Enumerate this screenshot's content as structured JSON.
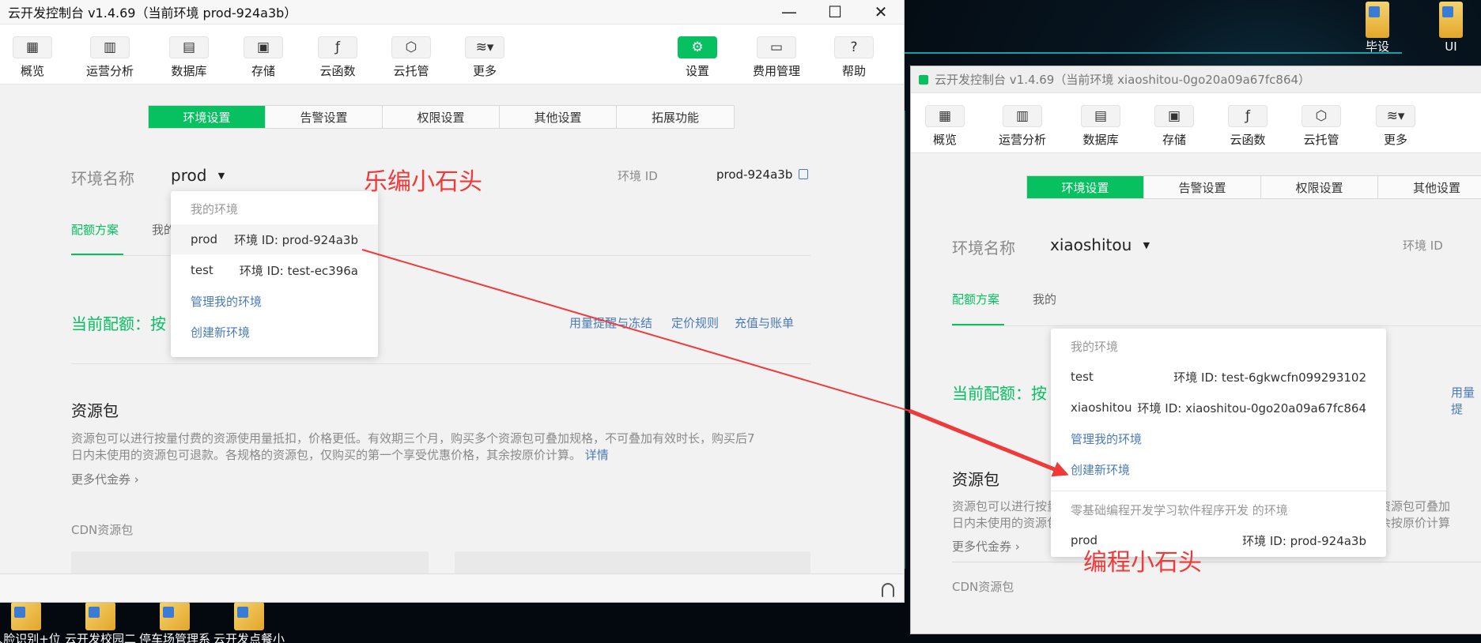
{
  "desktop": {
    "icons_bottom": [
      "人脸识别+位置签到",
      "云开发校园二手交易",
      "停车场管理系统",
      "云开发点餐小程序"
    ],
    "icons_top": [
      "毕设",
      "UI"
    ]
  },
  "annotations": {
    "top": "乐编小石头",
    "bottom": "编程小石头",
    "arrow_color": "#f03a3a"
  },
  "win1": {
    "title": "云开发控制台 v1.4.69（当前环境 prod-924a3b）",
    "toolbar": [
      {
        "icon": "grid-icon",
        "glyph": "▦",
        "label": "概览"
      },
      {
        "icon": "bar-chart-icon",
        "glyph": "▥",
        "label": "运营分析"
      },
      {
        "icon": "database-icon",
        "glyph": "▤",
        "label": "数据库"
      },
      {
        "icon": "storage-icon",
        "glyph": "▣",
        "label": "存储"
      },
      {
        "icon": "function-icon",
        "glyph": "ƒ",
        "label": "云函数"
      },
      {
        "icon": "cube-icon",
        "glyph": "⬡",
        "label": "云托管"
      },
      {
        "icon": "layers-icon",
        "glyph": "≋▾",
        "label": "更多"
      },
      {
        "icon": "gear-icon",
        "glyph": "⚙",
        "label": "设置",
        "active": true
      },
      {
        "icon": "billing-icon",
        "glyph": "▭",
        "label": "费用管理"
      },
      {
        "icon": "help-icon",
        "glyph": "?",
        "label": "帮助"
      }
    ],
    "tabs": [
      "环境设置",
      "告警设置",
      "权限设置",
      "其他设置",
      "拓展功能"
    ],
    "env_name_label": "环境名称",
    "env_name": "prod",
    "env_id_label": "环境 ID",
    "env_id": "prod-924a3b",
    "subtab_quota": "配额方案",
    "subtab_mine": "我的",
    "current_quota": "当前配额：按",
    "links": [
      "用量提醒与冻结",
      "定价规则",
      "充值与账单"
    ],
    "resource_title": "资源包",
    "resource_desc_1": "资源包可以进行按量付费的资源使用量抵扣，价格更低。有效期三个月，购买多个资源包可叠加规格，不可叠加有效时长，购买后7",
    "resource_desc_2": "日内未使用的资源包可退款。各规格的资源包，仅购买的第一个享受优惠价格，其余按原价计算。",
    "detail_link": "详情",
    "more_coupons": "更多代金券 ›",
    "cdn_label": "CDN资源包",
    "dropdown": {
      "header": "我的环境",
      "items": [
        {
          "name": "prod",
          "id": "环境 ID: prod-924a3b"
        },
        {
          "name": "test",
          "id": "环境 ID: test-ec396a"
        }
      ],
      "manage": "管理我的环境",
      "create": "创建新环境"
    }
  },
  "win2": {
    "title": "云开发控制台 v1.4.69（当前环境 xiaoshitou-0go20a09a67fc864）",
    "toolbar": [
      {
        "icon": "grid-icon",
        "glyph": "▦",
        "label": "概览"
      },
      {
        "icon": "bar-chart-icon",
        "glyph": "▥",
        "label": "运营分析"
      },
      {
        "icon": "database-icon",
        "glyph": "▤",
        "label": "数据库"
      },
      {
        "icon": "storage-icon",
        "glyph": "▣",
        "label": "存储"
      },
      {
        "icon": "function-icon",
        "glyph": "ƒ",
        "label": "云函数"
      },
      {
        "icon": "cube-icon",
        "glyph": "⬡",
        "label": "云托管"
      },
      {
        "icon": "layers-icon",
        "glyph": "≋▾",
        "label": "更多"
      }
    ],
    "tabs": [
      "环境设置",
      "告警设置",
      "权限设置",
      "其他设置"
    ],
    "env_name_label": "环境名称",
    "env_name": "xiaoshitou",
    "env_id_label": "环境 ID",
    "subtab_quota": "配额方案",
    "subtab_mine": "我的",
    "current_quota": "当前配额：按",
    "link_partial": "用量提",
    "resource_title": "资源包",
    "resource_desc_1": "资源包可以进行按量付费的资源使用量抵扣，价格更低。有效期三个月，购买多个资源包可叠加",
    "resource_desc_2": "日内未使用的资源包可退款。各规格的资源包，仅购买的第一个享受优惠价格，其余按原价计算",
    "more_coupons": "更多代金券 ›",
    "cdn_label": "CDN资源包",
    "dropdown": {
      "header": "我的环境",
      "items": [
        {
          "name": "test",
          "id": "环境 ID: test-6gkwcfn099293102"
        },
        {
          "name": "xiaoshitou",
          "id": "环境 ID: xiaoshitou-0go20a09a67fc864"
        }
      ],
      "manage": "管理我的环境",
      "create": "创建新环境",
      "shared_header": "零基础编程开发学习软件程序开发 的环境",
      "shared_items": [
        {
          "name": "prod",
          "id": "环境 ID: prod-924a3b"
        }
      ]
    }
  }
}
